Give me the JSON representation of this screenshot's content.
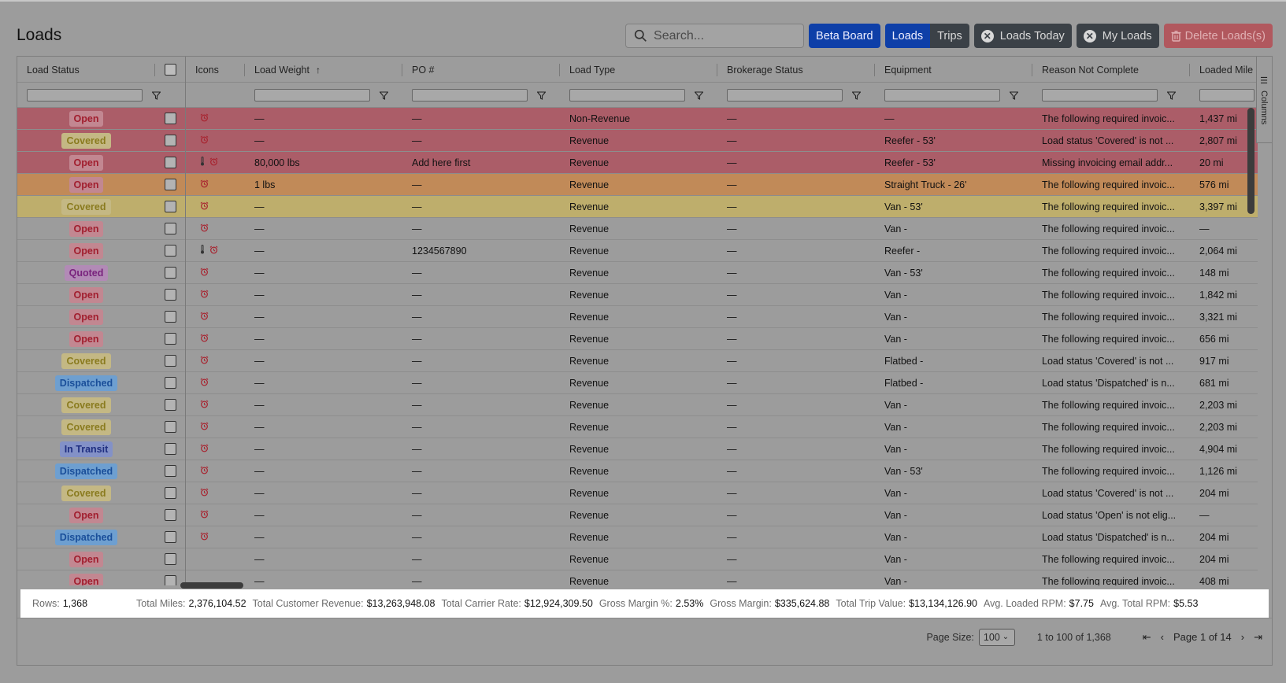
{
  "page": {
    "title": "Loads"
  },
  "toolbar": {
    "search_placeholder": "Search...",
    "beta_board": "Beta Board",
    "loads": "Loads",
    "trips": "Trips",
    "loads_today": "Loads Today",
    "my_loads": "My Loads",
    "delete_loads": "Delete Loads(s)"
  },
  "grid": {
    "columns": [
      "Load Status",
      "",
      "Icons",
      "Load Weight",
      "PO #",
      "Load Type",
      "Brokerage Status",
      "Equipment",
      "Reason Not Complete",
      "Loaded Mile"
    ],
    "side_panel": "Columns",
    "rows": [
      {
        "status": "Open",
        "weight": "—",
        "po": "—",
        "type": "Non-Revenue",
        "brok": "—",
        "equip": "—",
        "reason": "The following required invoic...",
        "miles": "1,437 mi",
        "icons": "alarm",
        "hl": "red"
      },
      {
        "status": "Covered",
        "weight": "—",
        "po": "—",
        "type": "Revenue",
        "brok": "—",
        "equip": "Reefer - 53'",
        "reason": "Load status 'Covered' is not ...",
        "miles": "2,807 mi",
        "icons": "alarm",
        "hl": "red"
      },
      {
        "status": "Open",
        "weight": "80,000 lbs",
        "po": "Add here first",
        "type": "Revenue",
        "brok": "—",
        "equip": "Reefer - 53'",
        "reason": "Missing invoicing email addr...",
        "miles": "20 mi",
        "icons": "temp-alarm",
        "hl": "red"
      },
      {
        "status": "Open",
        "weight": "1 lbs",
        "po": "—",
        "type": "Revenue",
        "brok": "—",
        "equip": "Straight Truck - 26'",
        "reason": "The following required invoic...",
        "miles": "576 mi",
        "icons": "alarm",
        "hl": "orange"
      },
      {
        "status": "Covered",
        "weight": "—",
        "po": "—",
        "type": "Revenue",
        "brok": "—",
        "equip": "Van - 53'",
        "reason": "The following required invoic...",
        "miles": "3,397 mi",
        "icons": "alarm",
        "hl": "yellow"
      },
      {
        "status": "Open",
        "weight": "—",
        "po": "—",
        "type": "Revenue",
        "brok": "—",
        "equip": "Van -",
        "reason": "The following required invoic...",
        "miles": "—",
        "icons": "alarm",
        "hl": ""
      },
      {
        "status": "Open",
        "weight": "—",
        "po": "1234567890",
        "type": "Revenue",
        "brok": "—",
        "equip": "Reefer -",
        "reason": "The following required invoic...",
        "miles": "2,064 mi",
        "icons": "temp-alarm",
        "hl": ""
      },
      {
        "status": "Quoted",
        "weight": "—",
        "po": "—",
        "type": "Revenue",
        "brok": "—",
        "equip": "Van - 53'",
        "reason": "The following required invoic...",
        "miles": "148 mi",
        "icons": "alarm",
        "hl": ""
      },
      {
        "status": "Open",
        "weight": "—",
        "po": "—",
        "type": "Revenue",
        "brok": "—",
        "equip": "Van -",
        "reason": "The following required invoic...",
        "miles": "1,842 mi",
        "icons": "alarm",
        "hl": ""
      },
      {
        "status": "Open",
        "weight": "—",
        "po": "—",
        "type": "Revenue",
        "brok": "—",
        "equip": "Van -",
        "reason": "The following required invoic...",
        "miles": "3,321 mi",
        "icons": "alarm",
        "hl": ""
      },
      {
        "status": "Open",
        "weight": "—",
        "po": "—",
        "type": "Revenue",
        "brok": "—",
        "equip": "Van -",
        "reason": "The following required invoic...",
        "miles": "656 mi",
        "icons": "alarm",
        "hl": ""
      },
      {
        "status": "Covered",
        "weight": "—",
        "po": "—",
        "type": "Revenue",
        "brok": "—",
        "equip": "Flatbed -",
        "reason": "Load status 'Covered' is not ...",
        "miles": "917 mi",
        "icons": "alarm",
        "hl": ""
      },
      {
        "status": "Dispatched",
        "weight": "—",
        "po": "—",
        "type": "Revenue",
        "brok": "—",
        "equip": "Flatbed -",
        "reason": "Load status 'Dispatched' is n...",
        "miles": "681 mi",
        "icons": "alarm",
        "hl": ""
      },
      {
        "status": "Covered",
        "weight": "—",
        "po": "—",
        "type": "Revenue",
        "brok": "—",
        "equip": "Van -",
        "reason": "The following required invoic...",
        "miles": "2,203 mi",
        "icons": "alarm",
        "hl": ""
      },
      {
        "status": "Covered",
        "weight": "—",
        "po": "—",
        "type": "Revenue",
        "brok": "—",
        "equip": "Van -",
        "reason": "The following required invoic...",
        "miles": "2,203 mi",
        "icons": "alarm",
        "hl": ""
      },
      {
        "status": "In Transit",
        "weight": "—",
        "po": "—",
        "type": "Revenue",
        "brok": "—",
        "equip": "Van -",
        "reason": "The following required invoic...",
        "miles": "4,904 mi",
        "icons": "alarm",
        "hl": ""
      },
      {
        "status": "Dispatched",
        "weight": "—",
        "po": "—",
        "type": "Revenue",
        "brok": "—",
        "equip": "Van - 53'",
        "reason": "The following required invoic...",
        "miles": "1,126 mi",
        "icons": "alarm",
        "hl": ""
      },
      {
        "status": "Covered",
        "weight": "—",
        "po": "—",
        "type": "Revenue",
        "brok": "—",
        "equip": "Van -",
        "reason": "Load status 'Covered' is not ...",
        "miles": "204 mi",
        "icons": "alarm",
        "hl": ""
      },
      {
        "status": "Open",
        "weight": "—",
        "po": "—",
        "type": "Revenue",
        "brok": "—",
        "equip": "Van -",
        "reason": "Load status 'Open' is not elig...",
        "miles": "—",
        "icons": "alarm",
        "hl": ""
      },
      {
        "status": "Dispatched",
        "weight": "—",
        "po": "—",
        "type": "Revenue",
        "brok": "—",
        "equip": "Van -",
        "reason": "Load status 'Dispatched' is n...",
        "miles": "204 mi",
        "icons": "alarm",
        "hl": ""
      },
      {
        "status": "Open",
        "weight": "—",
        "po": "—",
        "type": "Revenue",
        "brok": "—",
        "equip": "Van -",
        "reason": "The following required invoic...",
        "miles": "204 mi",
        "icons": "",
        "hl": ""
      },
      {
        "status": "Open",
        "weight": "—",
        "po": "—",
        "type": "Revenue",
        "brok": "—",
        "equip": "Van -",
        "reason": "The following required invoic...",
        "miles": "408 mi",
        "icons": "",
        "hl": ""
      }
    ]
  },
  "totals": [
    {
      "label": "Rows:",
      "value": "1,368"
    },
    {
      "label": "Total Miles:",
      "value": "2,376,104.52"
    },
    {
      "label": "Total Customer Revenue:",
      "value": "$13,263,948.08"
    },
    {
      "label": "Total Carrier Rate:",
      "value": "$12,924,309.50"
    },
    {
      "label": "Gross Margin %:",
      "value": "2.53%"
    },
    {
      "label": "Gross Margin:",
      "value": "$335,624.88"
    },
    {
      "label": "Total Trip Value:",
      "value": "$13,134,126.90"
    },
    {
      "label": "Avg. Loaded RPM:",
      "value": "$7.75"
    },
    {
      "label": "Avg. Total RPM:",
      "value": "$5.53"
    }
  ],
  "pager": {
    "page_size_label": "Page Size:",
    "page_size": "100",
    "range": "1 to 100 of 1,368",
    "page_info": "Page 1 of 14"
  },
  "colors": {
    "primary_blue": "#0e3fa8",
    "dark_button": "#3b4147",
    "delete_red": "#b1585e",
    "row_red": "#ab5d68",
    "row_orange": "#c18a58",
    "row_yellow": "#beae6c"
  }
}
